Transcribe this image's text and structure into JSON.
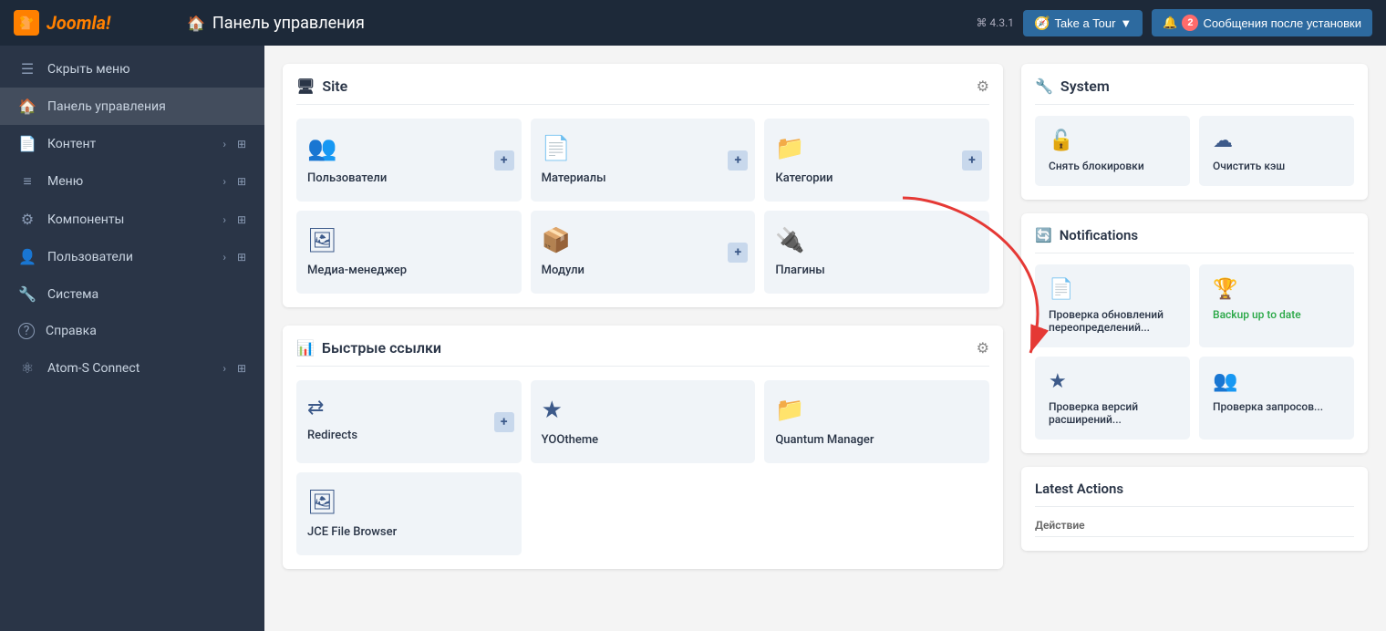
{
  "topbar": {
    "logo": "Joomla!",
    "logo_icon": "J",
    "page_title": "Панель управления",
    "house_char": "⌂",
    "version": "⌘ 4.3.1",
    "tour_label": "Take a Tour",
    "tour_icon": "▼",
    "notif_count": "2",
    "notif_label": "Сообщения после установки"
  },
  "sidebar": {
    "items": [
      {
        "id": "hide-menu",
        "icon": "☰",
        "label": "Скрыть меню",
        "has_arrow": false,
        "has_grid": false
      },
      {
        "id": "dashboard",
        "icon": "⌂",
        "label": "Панель управления",
        "has_arrow": false,
        "has_grid": false,
        "active": true
      },
      {
        "id": "content",
        "icon": "📄",
        "label": "Контент",
        "has_arrow": true,
        "has_grid": true
      },
      {
        "id": "menu",
        "icon": "≡",
        "label": "Меню",
        "has_arrow": true,
        "has_grid": true
      },
      {
        "id": "components",
        "icon": "⚙",
        "label": "Компоненты",
        "has_arrow": true,
        "has_grid": true
      },
      {
        "id": "users",
        "icon": "👤",
        "label": "Пользователи",
        "has_arrow": true,
        "has_grid": true
      },
      {
        "id": "system",
        "icon": "🔧",
        "label": "Система",
        "has_arrow": false,
        "has_grid": false
      },
      {
        "id": "help",
        "icon": "?",
        "label": "Справка",
        "has_arrow": false,
        "has_grid": false
      },
      {
        "id": "atom",
        "icon": "⚛",
        "label": "Atom-S Connect",
        "has_arrow": true,
        "has_grid": true
      }
    ]
  },
  "site_panel": {
    "title": "Site",
    "title_icon": "🖥",
    "items": [
      {
        "id": "users",
        "icon": "👥",
        "label": "Пользователи",
        "has_plus": true
      },
      {
        "id": "materials",
        "icon": "📄",
        "label": "Материалы",
        "has_plus": true
      },
      {
        "id": "categories",
        "icon": "📁",
        "label": "Категории",
        "has_plus": true
      },
      {
        "id": "media",
        "icon": "🖼",
        "label": "Медиа-менеджер",
        "has_plus": false
      },
      {
        "id": "modules",
        "icon": "📦",
        "label": "Модули",
        "has_plus": true
      },
      {
        "id": "plugins",
        "icon": "🔌",
        "label": "Плагины",
        "has_plus": false
      }
    ]
  },
  "quick_links_panel": {
    "title": "Быстрые ссылки",
    "title_icon": "📊",
    "items": [
      {
        "id": "redirects",
        "icon": "⇄",
        "label": "Redirects",
        "has_plus": true
      },
      {
        "id": "yootheme",
        "icon": "★",
        "label": "YOOtheme",
        "has_plus": false
      },
      {
        "id": "quantum",
        "icon": "📁",
        "label": "Quantum Manager",
        "has_plus": false
      },
      {
        "id": "jce",
        "icon": "🖼",
        "label": "JCE File Browser",
        "has_plus": false
      }
    ]
  },
  "system_panel": {
    "title": "System",
    "title_icon": "🔧",
    "items": [
      {
        "id": "unlock",
        "icon": "🔓",
        "label": "Снять блокировки"
      },
      {
        "id": "clear_cache",
        "icon": "☁",
        "label": "Очистить кэш"
      }
    ]
  },
  "notifications_panel": {
    "title": "Notifications",
    "title_icon": "🔄",
    "items": [
      {
        "id": "check_updates",
        "icon": "📄",
        "label": "Проверка обновлений переопределений..."
      },
      {
        "id": "backup",
        "icon": "🏆",
        "label": "Backup up to date",
        "is_green": true
      },
      {
        "id": "check_ext",
        "icon": "★",
        "label": "Проверка версий расширений..."
      },
      {
        "id": "check_req",
        "icon": "👥",
        "label": "Проверка запросов..."
      }
    ]
  },
  "latest_actions": {
    "title": "Latest Actions",
    "columns": [
      "Действие"
    ]
  }
}
